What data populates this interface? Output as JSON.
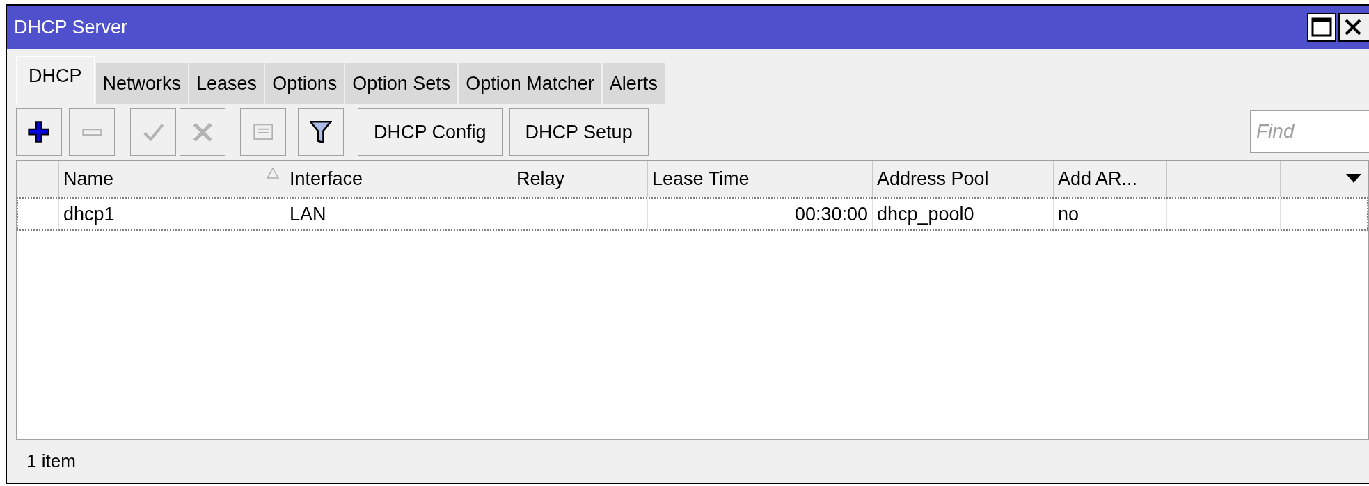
{
  "window": {
    "title": "DHCP Server"
  },
  "tabs": [
    {
      "label": "DHCP",
      "selected": true
    },
    {
      "label": "Networks",
      "selected": false
    },
    {
      "label": "Leases",
      "selected": false
    },
    {
      "label": "Options",
      "selected": false
    },
    {
      "label": "Option Sets",
      "selected": false
    },
    {
      "label": "Option Matcher",
      "selected": false
    },
    {
      "label": "Alerts",
      "selected": false
    }
  ],
  "toolbar": {
    "icon_buttons": [
      {
        "kind": "add",
        "disabled": false
      },
      {
        "kind": "remove",
        "disabled": true
      },
      {
        "kind": "enable",
        "disabled": true
      },
      {
        "kind": "disable",
        "disabled": true
      },
      {
        "kind": "comment",
        "disabled": true
      },
      {
        "kind": "filter",
        "disabled": false
      }
    ],
    "buttons": [
      "DHCP Config",
      "DHCP Setup"
    ],
    "search": {
      "placeholder": "Find"
    }
  },
  "table": {
    "columns": [
      {
        "label": "Name",
        "sorted": true,
        "kind": "text"
      },
      {
        "label": "Interface",
        "sorted": false,
        "kind": "text"
      },
      {
        "label": "Relay",
        "sorted": false,
        "kind": "text"
      },
      {
        "label": "Lease Time",
        "sorted": false,
        "kind": "time"
      },
      {
        "label": "Address Pool",
        "sorted": false,
        "kind": "text"
      },
      {
        "label": "Add AR...",
        "sorted": false,
        "kind": "text"
      }
    ],
    "rows": [
      {
        "focused": true,
        "name": "dhcp1",
        "interface": "LAN",
        "lease_time": "00:30:00",
        "address_pool": "dhcp_pool0",
        "add_arp": "no"
      }
    ]
  },
  "status_bar": "1 item"
}
